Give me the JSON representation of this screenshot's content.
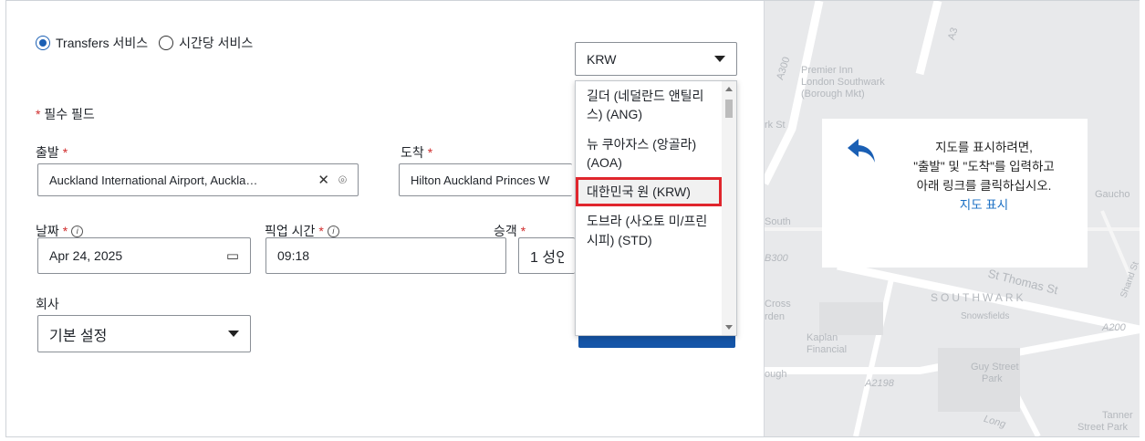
{
  "service": {
    "option_transfers": "Transfers 서비스",
    "option_hourly": "시간당 서비스"
  },
  "required_note": "필수 필드",
  "currency": {
    "selected": "KRW",
    "options": [
      "길더 (네덜란드 앤틸리스) (ANG)",
      "뉴 쿠아자스 (앙골라) (AOA)",
      "대한민국 원 (KRW)",
      "도브라 (사오토 미/프린시피) (STD)"
    ]
  },
  "from": {
    "label": "출발",
    "value": "Auckland International Airport, Auckla…"
  },
  "to": {
    "label": "도착",
    "value": "Hilton Auckland Princes W"
  },
  "date": {
    "label": "날짜",
    "value": "Apr 24, 2025"
  },
  "pickup_time": {
    "label": "픽업 시간",
    "value": "09:18"
  },
  "passengers": {
    "label": "승객",
    "value": "1 성인"
  },
  "company": {
    "label": "회사",
    "value": "기본 설정"
  },
  "map": {
    "card_line1": "지도를 표시하려면,",
    "card_line2": "\"출발\" 및 \"도착\"를 입력하고",
    "card_line3": "아래 링크를 클릭하십시오.",
    "card_link": "지도 표시",
    "labels": {
      "premier_inn": "Premier Inn",
      "london_southwark": "London Southwark",
      "borough_mkt": "(Borough Mkt)",
      "southwark": "SOUTHWARK",
      "st_thomas": "St Thomas St",
      "kaplan": "Kaplan",
      "financial": "Financial",
      "guy_street": "Guy Street",
      "park": "Park",
      "tanner": "Tanner",
      "street_park": "Street Park",
      "snowsfields": "Snowsfields",
      "a200": "A200",
      "a2198": "A2198",
      "a3": "A3",
      "a300": "A300",
      "gaucho": "Gaucho",
      "cross": "Cross",
      "borough": "ough",
      "b300": "B300",
      "long": "Long",
      "south": "South",
      "rden": "rden",
      "rk_st": "rk St",
      "shand": "Shand St"
    }
  }
}
